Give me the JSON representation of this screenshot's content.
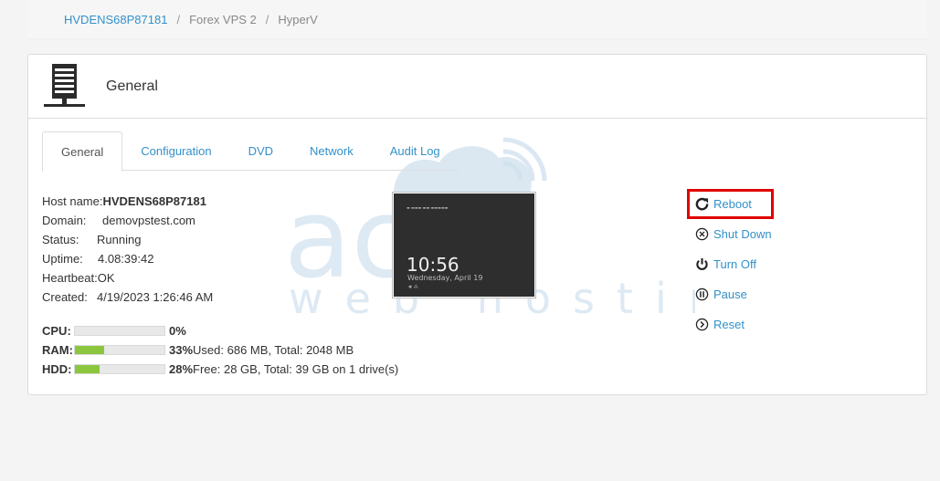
{
  "breadcrumb": {
    "items": [
      "HVDENS68P87181",
      "Forex VPS 2",
      "HyperV"
    ],
    "separator": "/"
  },
  "panel": {
    "title": "General"
  },
  "tabs": [
    "General",
    "Configuration",
    "DVD",
    "Network",
    "Audit Log"
  ],
  "info": {
    "hostname_label": "Host name:",
    "hostname": "HVDENS68P87181",
    "domain_label": "Domain:",
    "domain": "demovpstest.com",
    "status_label": "Status:",
    "status": "Running",
    "uptime_label": "Uptime:",
    "uptime": "4.08:39:42",
    "heartbeat_label": "Heartbeat:",
    "heartbeat": "OK",
    "created_label": "Created:",
    "created": "4/19/2023 1:26:46 AM"
  },
  "usage": {
    "cpu": {
      "label": "CPU:",
      "percent": "0%",
      "fraction": 0.0,
      "detail": ""
    },
    "ram": {
      "label": "RAM:",
      "percent": "33%",
      "fraction": 0.33,
      "detail": "Used: 686 MB, Total: 2048 MB"
    },
    "hdd": {
      "label": "HDD:",
      "percent": "28%",
      "fraction": 0.28,
      "detail": "Free: 28 GB, Total: 39 GB on 1 drive(s)"
    }
  },
  "preview": {
    "clock": "10:56",
    "date": "Wednesday, April 19"
  },
  "actions": {
    "reboot": "Reboot",
    "shutdown": "Shut Down",
    "turnoff": "Turn Off",
    "pause": "Pause",
    "reset": "Reset"
  },
  "watermark": {
    "line1": "accu",
    "line2": "web hosting"
  },
  "colors": {
    "link": "#3391c9",
    "bar_fill": "#8cc63f",
    "highlight": "#e00000"
  }
}
